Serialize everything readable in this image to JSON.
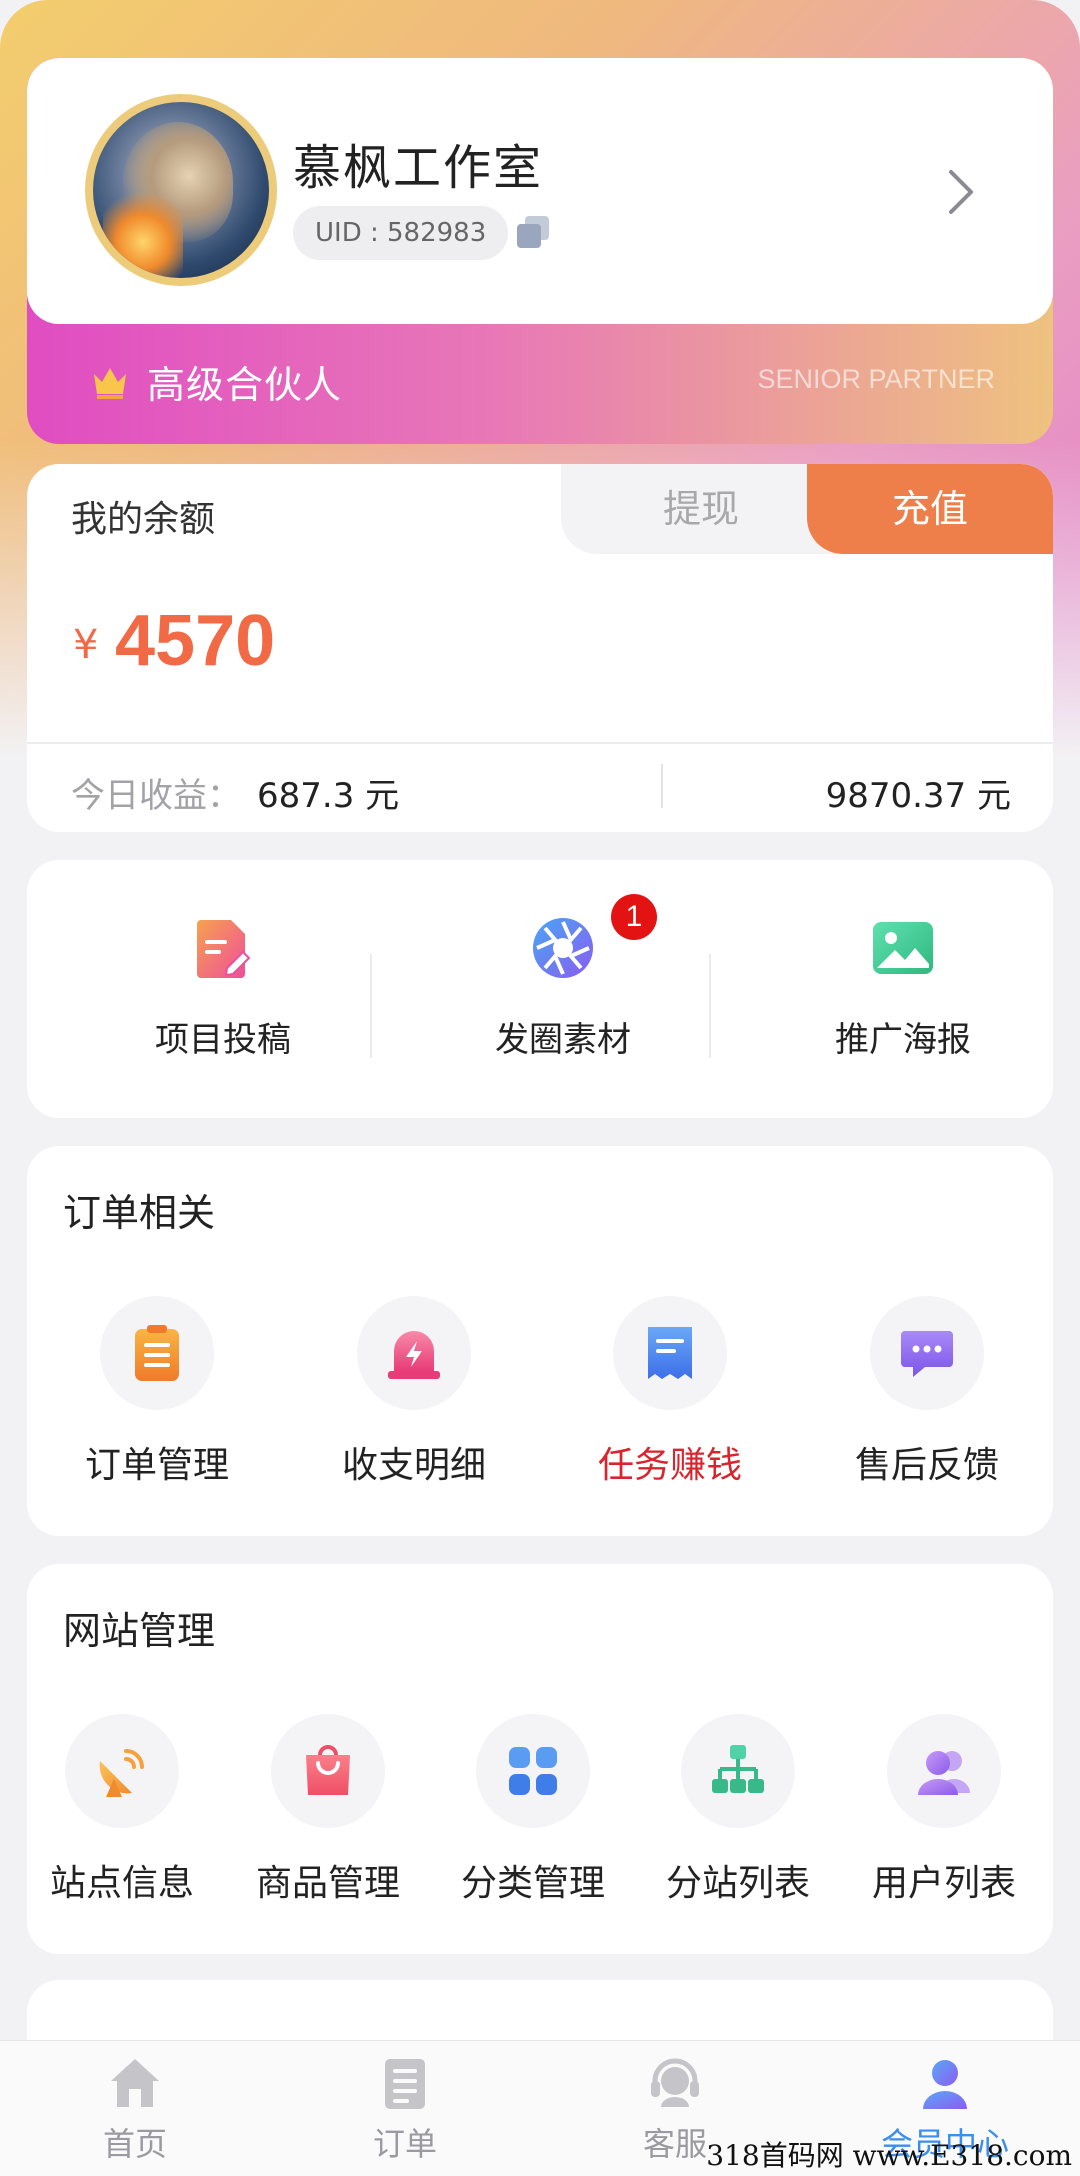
{
  "profile": {
    "name": "慕枫工作室",
    "uid": "UID : 582983",
    "level": "高级合伙人",
    "level_en": "SENIOR PARTNER"
  },
  "balance": {
    "title": "我的余额",
    "withdraw_label": "提现",
    "recharge_label": "充值",
    "currency": "¥",
    "amount": "4570",
    "today_label": "今日收益：",
    "today_value": "687.3 元",
    "total_value": "9870.37 元"
  },
  "tools": [
    {
      "label": "项目投稿",
      "icon": "document-edit-icon"
    },
    {
      "label": "发圈素材",
      "icon": "aperture-icon",
      "badge": "1"
    },
    {
      "label": "推广海报",
      "icon": "image-icon"
    }
  ],
  "orders": {
    "title": "订单相关",
    "items": [
      {
        "label": "订单管理",
        "icon": "clipboard-icon"
      },
      {
        "label": "收支明细",
        "icon": "alarm-bolt-icon"
      },
      {
        "label": "任务赚钱",
        "icon": "receipt-icon"
      },
      {
        "label": "售后反馈",
        "icon": "chat-bubble-icon"
      }
    ]
  },
  "site": {
    "title": "网站管理",
    "items": [
      {
        "label": "站点信息",
        "icon": "satellite-dish-icon"
      },
      {
        "label": "商品管理",
        "icon": "shopping-bag-icon"
      },
      {
        "label": "分类管理",
        "icon": "category-grid-icon"
      },
      {
        "label": "分站列表",
        "icon": "sitemap-icon"
      },
      {
        "label": "用户列表",
        "icon": "users-icon"
      }
    ]
  },
  "tabbar": {
    "items": [
      {
        "label": "首页",
        "icon": "home-icon"
      },
      {
        "label": "订单",
        "icon": "order-list-icon"
      },
      {
        "label": "客服",
        "icon": "headset-icon"
      },
      {
        "label": "会员中心",
        "icon": "member-icon"
      }
    ]
  },
  "colors": {
    "accent_orange": "#ef7f4a",
    "amount_red": "#f26a45",
    "tab_active": "#3a8ef0",
    "highlight_red": "#d9232d"
  },
  "watermark": "318首码网 www.E318.com"
}
